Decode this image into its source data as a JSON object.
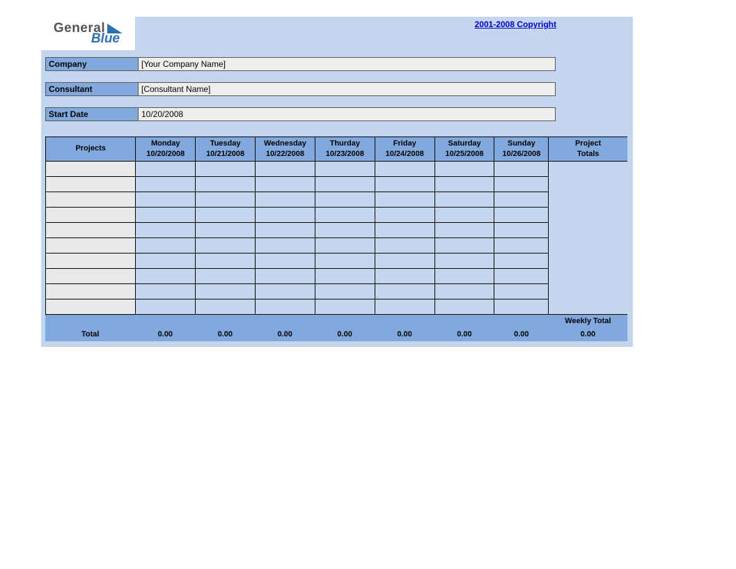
{
  "logo": {
    "word1": "General",
    "word2": "Blue"
  },
  "copyright": "2001-2008 Copyright",
  "info": {
    "company_label": "Company",
    "company_value": "[Your Company Name]",
    "consultant_label": "Consultant",
    "consultant_value": "[Consultant Name]",
    "startdate_label": "Start Date",
    "startdate_value": "10/20/2008"
  },
  "table": {
    "projects_header": "Projects",
    "project_totals_header_l1": "Project",
    "project_totals_header_l2": "Totals",
    "days": [
      {
        "name": "Monday",
        "date": "10/20/2008"
      },
      {
        "name": "Tuesday",
        "date": "10/21/2008"
      },
      {
        "name": "Wednesday",
        "date": "10/22/2008"
      },
      {
        "name": "Thurday",
        "date": "10/23/2008"
      },
      {
        "name": "Friday",
        "date": "10/24/2008"
      },
      {
        "name": "Saturday",
        "date": "10/25/2008"
      },
      {
        "name": "Sunday",
        "date": "10/26/2008"
      }
    ],
    "row_count": 10,
    "footer": {
      "total_label": "Total",
      "day_totals": [
        "0.00",
        "0.00",
        "0.00",
        "0.00",
        "0.00",
        "0.00",
        "0.00"
      ],
      "weekly_total_label": "Weekly Total",
      "weekly_total_value": "0.00"
    }
  }
}
